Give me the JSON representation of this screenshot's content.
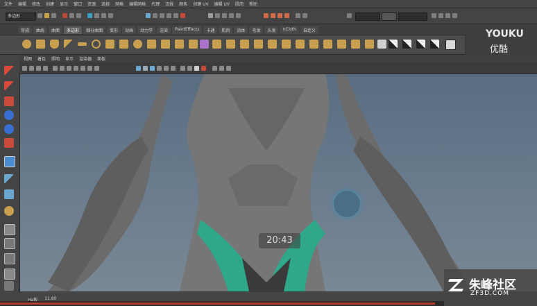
{
  "menubar": {
    "items": [
      "文件",
      "编辑",
      "修改",
      "创建",
      "显示",
      "窗口",
      "资源",
      "选择",
      "网格",
      "编辑网格",
      "代理",
      "法线",
      "颜色",
      "创建 UV",
      "编辑 UV",
      "肌肉",
      "帮助"
    ]
  },
  "statusline": {
    "mode": "多边形"
  },
  "shelf_tabs": {
    "tabs": [
      "常规",
      "曲线",
      "曲面",
      "多边形",
      "细分曲面",
      "变形",
      "动画",
      "动力学",
      "渲染",
      "PaintEffects",
      "卡通",
      "肌肉",
      "流体",
      "毛发",
      "头发",
      "nCloth",
      "自定义"
    ],
    "active_index": 3
  },
  "watermark_youku": {
    "title": "YOUKU",
    "subtitle": "优酷"
  },
  "panel_menu": {
    "items": [
      "视图",
      "着色",
      "照明",
      "显示",
      "渲染器",
      "面板"
    ]
  },
  "viewport": {
    "timestamp": "20:43"
  },
  "helpline": {
    "items": [
      "Ha板",
      "11.80"
    ]
  },
  "progress": {
    "value": 0.98
  },
  "watermark_zf3d": {
    "title": "朱峰社区",
    "url": "ZF3D.COM"
  }
}
